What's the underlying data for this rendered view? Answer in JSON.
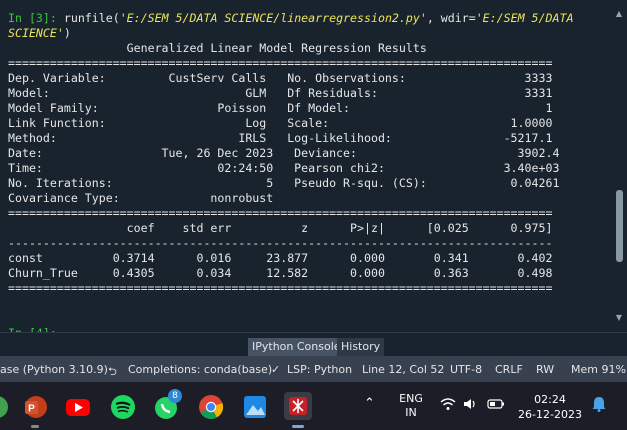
{
  "console": {
    "prompt_in3": "In [3]:",
    "command_call": " runfile(",
    "command_path": "'E:/SEM 5/DATA SCIENCE/linearregression2.py'",
    "command_mid": ", wdir=",
    "command_wdir_1": "'E:/SEM 5/DATA",
    "command_wdir_2": "SCIENCE'",
    "command_end": ")",
    "output_lines": [
      "                 Generalized Linear Model Regression Results",
      "==============================================================================",
      "Dep. Variable:         CustServ Calls   No. Observations:                 3333",
      "Model:                            GLM   Df Residuals:                     3331",
      "Model Family:                 Poisson   Df Model:                            1",
      "Link Function:                    Log   Scale:                          1.0000",
      "Method:                          IRLS   Log-Likelihood:                -5217.1",
      "Date:                 Tue, 26 Dec 2023   Deviance:                       3902.4",
      "Time:                         02:24:50   Pearson chi2:                 3.40e+03",
      "No. Iterations:                      5   Pseudo R-squ. (CS):            0.04261",
      "Covariance Type:             nonrobust",
      "==============================================================================",
      "                 coef    std err          z      P>|z|      [0.025      0.975]",
      "------------------------------------------------------------------------------",
      "const          0.3714      0.016     23.877      0.000       0.341       0.402",
      "Churn_True     0.4305      0.034     12.582      0.000       0.363       0.498",
      "=============================================================================="
    ],
    "prompt_in4": "In [4]:"
  },
  "tabs": [
    {
      "label": "IPython Console"
    },
    {
      "label": "History"
    }
  ],
  "status": {
    "interpreter": "ase (Python 3.10.9)",
    "completions": "Completions: conda(base)",
    "lsp": "LSP: Python",
    "position": "Line 12, Col 52",
    "encoding": "UTF-8",
    "eol": "CRLF",
    "permissions": "RW",
    "memory": "Mem 91%"
  },
  "taskbar": {
    "whatsapp_badge": "8",
    "lang_1": "ENG",
    "lang_2": "IN",
    "time": "02:24",
    "date": "26-12-2023"
  }
}
